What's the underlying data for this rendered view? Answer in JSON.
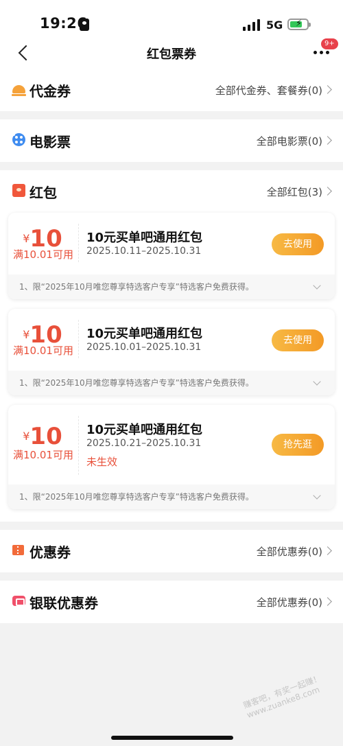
{
  "status_bar": {
    "time": "19:26",
    "network": "5G",
    "battery_color": "#34c759"
  },
  "nav": {
    "title": "红包票券",
    "badge": "9+"
  },
  "sections": {
    "voucher": {
      "title": "代金券",
      "link": "全部代金券、套餐券(0)",
      "icon": "voucher-icon"
    },
    "movie": {
      "title": "电影票",
      "link": "全部电影票(0)",
      "icon": "film-icon"
    },
    "redpacket": {
      "title": "红包",
      "link": "全部红包(3)",
      "icon": "red-packet-icon"
    },
    "coupon": {
      "title": "优惠券",
      "link": "全部优惠券(0)",
      "icon": "coupon-icon"
    },
    "unionpay": {
      "title": "银联优惠券",
      "link": "全部优惠券(0)",
      "icon": "unionpay-icon"
    }
  },
  "red_packets": [
    {
      "currency": "¥",
      "amount": "10",
      "condition": "满10.01可用",
      "name": "10元买单吧通用红包",
      "date": "2025.10.11–2025.10.31",
      "status": "",
      "button": "去使用",
      "note": "1、限“2025年10月唯您尊享特选客户专享”特选客户免费获得。"
    },
    {
      "currency": "¥",
      "amount": "10",
      "condition": "满10.01可用",
      "name": "10元买单吧通用红包",
      "date": "2025.10.01–2025.10.31",
      "status": "",
      "button": "去使用",
      "note": "1、限“2025年10月唯您尊享特选客户专享”特选客户免费获得。"
    },
    {
      "currency": "¥",
      "amount": "10",
      "condition": "满10.01可用",
      "name": "10元买单吧通用红包",
      "date": "2025.10.21–2025.10.31",
      "status": "未生效",
      "button": "抢先逛",
      "note": "1、限“2025年10月唯您尊享特选客户专享”特选客户免费获得。"
    }
  ],
  "watermark": "赚客吧，有奖一起赚！www.zuanke8.com",
  "colors": {
    "accent_red": "#e8503a",
    "button_orange": "#f39a26",
    "background": "#f2f2f2"
  }
}
